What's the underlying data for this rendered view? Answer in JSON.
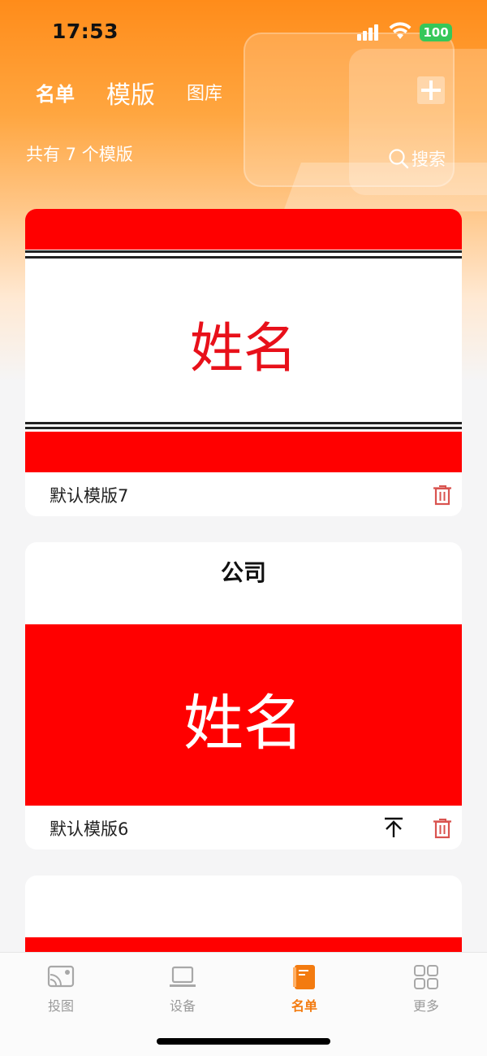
{
  "status_bar": {
    "time": "17:53",
    "battery": "100"
  },
  "top_nav": {
    "tabs": [
      {
        "label": "名单"
      },
      {
        "label": "模版"
      },
      {
        "label": "图库"
      }
    ]
  },
  "summary": {
    "count_text": "共有 7 个模版"
  },
  "search": {
    "label": "搜索"
  },
  "templates": [
    {
      "title": "默认模版7",
      "preview_name": "姓名"
    },
    {
      "title": "默认模版6",
      "preview_company": "公司",
      "preview_name": "姓名"
    }
  ],
  "tabbar": {
    "items": [
      {
        "label": "投图",
        "icon": "cast-icon"
      },
      {
        "label": "设备",
        "icon": "laptop-icon"
      },
      {
        "label": "名单",
        "icon": "list-icon"
      },
      {
        "label": "更多",
        "icon": "grid-icon"
      }
    ]
  },
  "colors": {
    "accent": "#f37b10",
    "template_red": "#ff0000",
    "delete_icon": "#d9534f"
  }
}
